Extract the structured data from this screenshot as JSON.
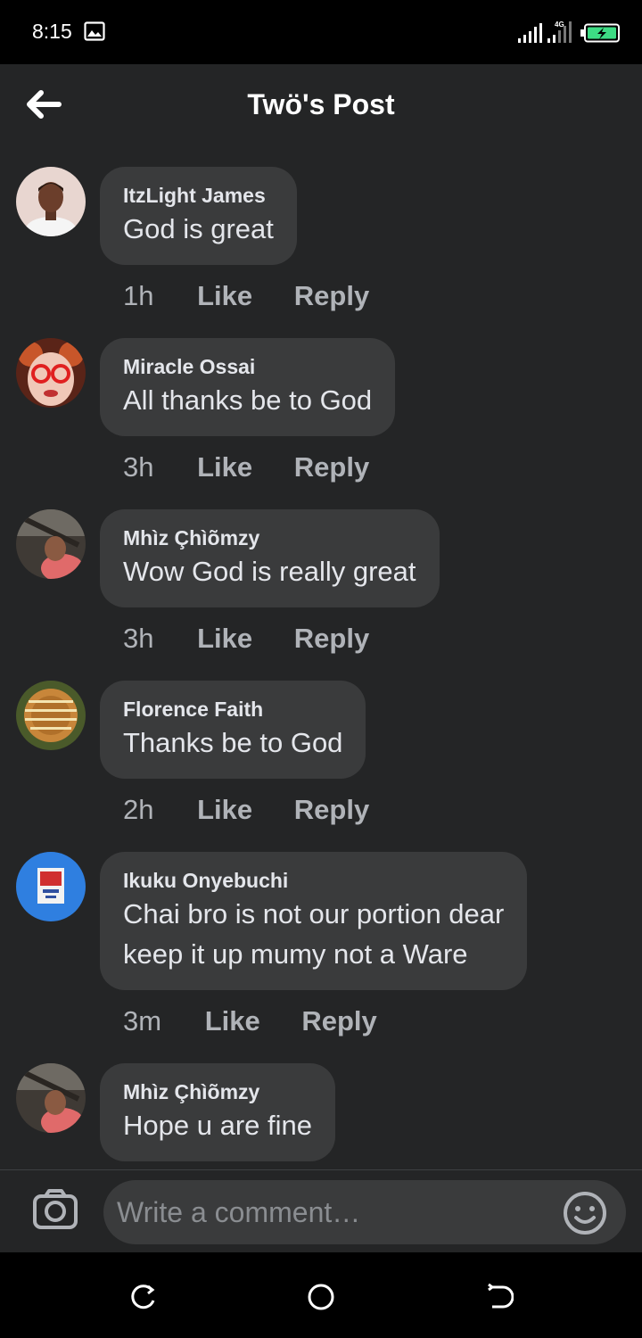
{
  "status_bar": {
    "time": "8:15",
    "network": "4G",
    "icons": [
      "gallery-icon",
      "signal-icon",
      "signal-icon",
      "battery-charging-icon"
    ]
  },
  "header": {
    "title": "Twö's Post",
    "back_icon": "arrow-left-icon"
  },
  "comments": [
    {
      "author": "ItzLight James",
      "text": "God is great",
      "time": "1h",
      "like_label": "Like",
      "reply_label": "Reply"
    },
    {
      "author": "Miracle Ossai",
      "text": "All thanks be to God",
      "time": "3h",
      "like_label": "Like",
      "reply_label": "Reply"
    },
    {
      "author": "Mhìz Çhìõmzy",
      "text": "Wow God is really great",
      "time": "3h",
      "like_label": "Like",
      "reply_label": "Reply"
    },
    {
      "author": "Florence Faith",
      "text": "Thanks be to God",
      "time": "2h",
      "like_label": "Like",
      "reply_label": "Reply"
    },
    {
      "author": "Ikuku Onyebuchi",
      "text": "Chai bro is not our portion dear\nkeep it up mumy not a Ware",
      "time": "3m",
      "like_label": "Like",
      "reply_label": "Reply"
    },
    {
      "author": "Mhìz Çhìõmzy",
      "text": "Hope u are fine"
    }
  ],
  "composer": {
    "placeholder": "Write a comment…",
    "camera_icon": "camera-icon",
    "emoji_icon": "emoji-icon"
  },
  "nav_bar": {
    "icons": [
      "recent-apps-icon",
      "home-icon",
      "back-icon"
    ]
  },
  "colors": {
    "background": "#242526",
    "bubble": "#3a3b3c",
    "primary_text": "#e4e6eb",
    "secondary_text": "#b0b3b8",
    "status_bar": "#000000",
    "battery_charge": "#3ddc84"
  }
}
